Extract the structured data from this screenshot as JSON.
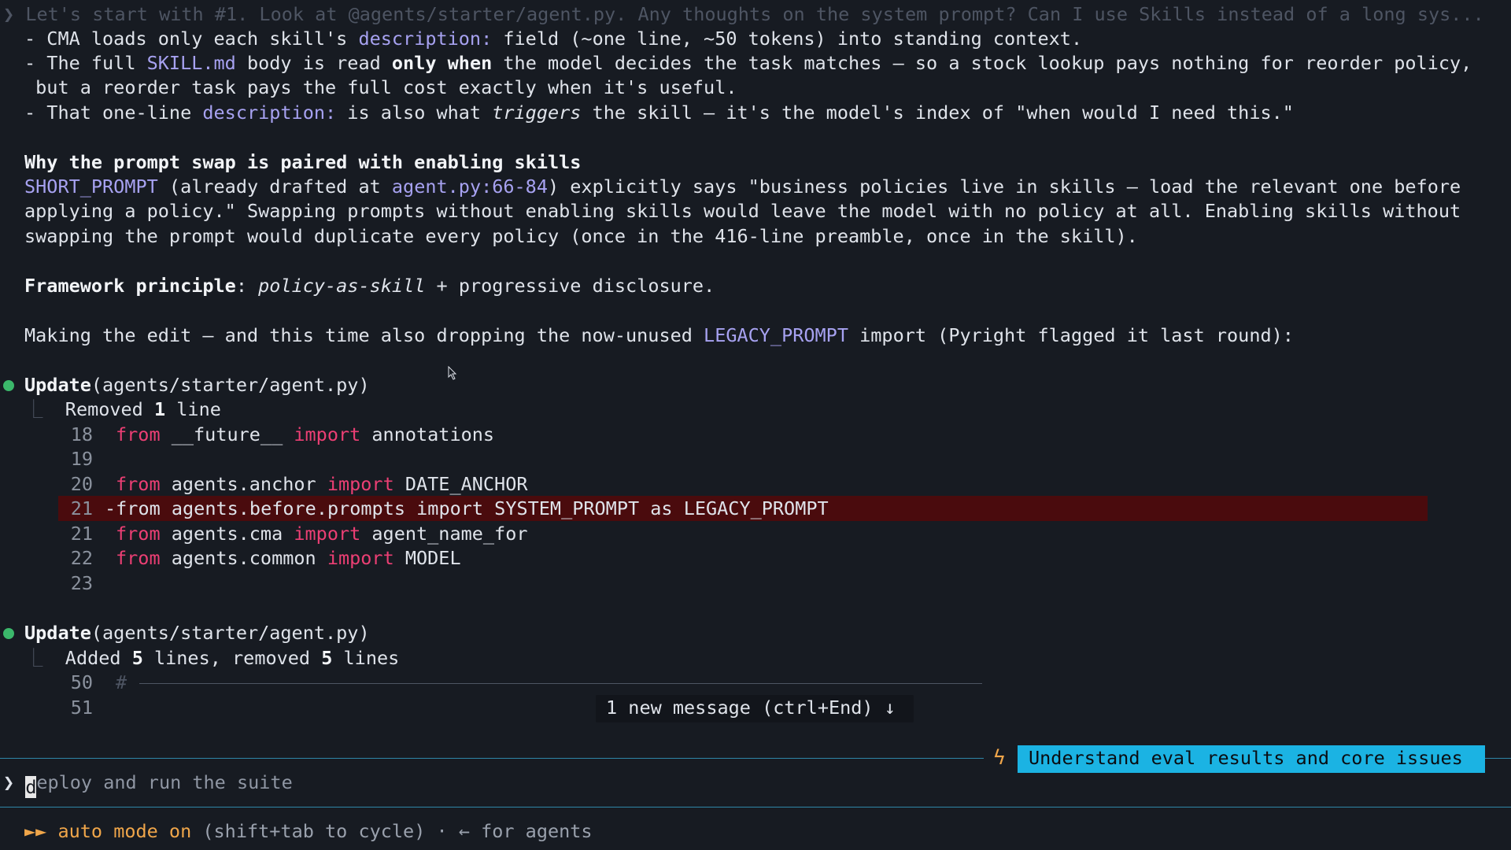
{
  "colors": {
    "accent": "#a7a2f1",
    "keyword": "#ec3f74",
    "dot": "#3bb86b",
    "badge": "#1bb3e3",
    "auto": "#f0a64a",
    "removed_bg": "#4a0b0d"
  },
  "top_faded": "Let's start with #1. Look at @agents/starter/agent.py. Any thoughts on the system prompt? Can I use Skills instead of a long sys...",
  "b1": {
    "pre": "- CMA loads only each skill's ",
    "acc": "description:",
    "post": " field (~one line, ~50 tokens) into standing context."
  },
  "b2": {
    "pre": "- The full ",
    "acc": "SKILL.md",
    "mid": " body is read ",
    "bold": "only when",
    "post": " the model decides the task matches — so a stock lookup pays nothing for reorder policy,"
  },
  "b2_cont": " but a reorder task pays the full cost exactly when it's useful.",
  "b3": {
    "pre": "- That one-line ",
    "acc": "description:",
    "mid": " is also what ",
    "ital": "triggers",
    "post": " the skill — it's the model's index of \"when would I need this.\""
  },
  "heading": "Why the prompt swap is paired with enabling skills",
  "p1": {
    "acc1": "SHORT_PROMPT",
    "t1": " (already drafted at ",
    "acc2": "agent.py:66-84",
    "t2": ") explicitly says \"business policies live in skills — load the relevant one before"
  },
  "p2": "applying a policy.\" Swapping prompts without enabling skills would leave the model with no policy at all. Enabling skills without",
  "p3": "swapping the prompt would duplicate every policy (once in the 416-line preamble, once in the skill).",
  "principle": {
    "label": "Framework principle",
    "colon": ":",
    "ital": "policy-as-skill",
    "rest": " + progressive disclosure."
  },
  "making": {
    "pre": "Making the edit — and this time also dropping the now-unused ",
    "acc": "LEGACY_PROMPT",
    "post": " import (Pyright flagged it last round):"
  },
  "update1": {
    "tool": "Update",
    "arg": "(agents/starter/agent.py)",
    "sum_pre": "Removed ",
    "sum_n": "1",
    "sum_post": " line"
  },
  "diff1": [
    {
      "n": "18",
      "kw1": "from",
      "mod": " __future__ ",
      "kw2": "import",
      "name": " annotations"
    },
    {
      "n": "19"
    },
    {
      "n": "20",
      "kw1": "from",
      "mod": " agents.anchor ",
      "kw2": "import",
      "name": " DATE_ANCHOR"
    },
    {
      "n": "21",
      "removed": "-from agents.before.prompts import SYSTEM_PROMPT as LEGACY_PROMPT"
    },
    {
      "n": "21",
      "kw1": "from",
      "mod": " agents.cma ",
      "kw2": "import",
      "name": " agent_name_for"
    },
    {
      "n": "22",
      "kw1": "from",
      "mod": " agents.common ",
      "kw2": "import",
      "name": " MODEL"
    },
    {
      "n": "23"
    }
  ],
  "update2": {
    "tool": "Update",
    "arg": "(agents/starter/agent.py)",
    "sum_pre": "Added ",
    "sum_n1": "5",
    "sum_mid": " lines, removed ",
    "sum_n2": "5",
    "sum_post": " lines"
  },
  "diff2": [
    {
      "n": "50",
      "hash": "#"
    },
    {
      "n": "51"
    }
  ],
  "tooltip": "1 new message (ctrl+End) ↓",
  "task_badge": "Understand eval results and core issues",
  "prompt": {
    "symbol": "❯",
    "first": "d",
    "rest": "eploy and run the suite"
  },
  "status": {
    "arrows": "►►",
    "mode": "auto mode on",
    "hint": " (shift+tab to cycle) · ← for agents"
  },
  "lightning": "ϟ"
}
